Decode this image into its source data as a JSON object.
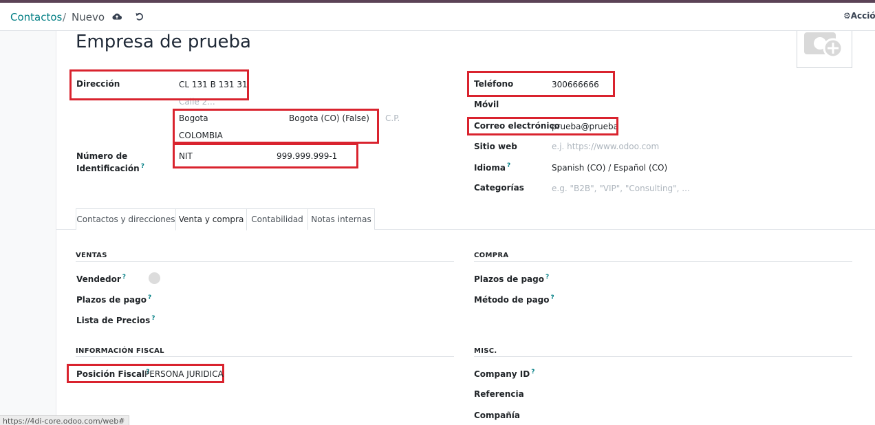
{
  "breadcrumb": {
    "parent": "Contactos",
    "separator": "/",
    "current": "Nuevo"
  },
  "actions_label": "Acción",
  "icons": {
    "save": "cloud-upload-icon",
    "discard": "undo-icon",
    "actions": "gear-icon",
    "avatar": "camera-plus-icon"
  },
  "record": {
    "name": "Empresa de prueba"
  },
  "address": {
    "label": "Dirección",
    "street": "CL 131 B 131 31",
    "street2_placeholder": "Calle 2...",
    "city": "Bogota",
    "state": "Bogota (CO) (False)",
    "zip_placeholder": "C.P.",
    "country": "COLOMBIA"
  },
  "identification": {
    "label_line1": "Número de",
    "label_line2": "Identificación",
    "help": "?",
    "type": "NIT",
    "number": "999.999.999-1"
  },
  "contact": {
    "phone_label": "Teléfono",
    "phone": "300666666",
    "mobile_label": "Móvil",
    "email_label": "Correo electrónico",
    "email": "prueba@prueba",
    "website_label": "Sitio web",
    "website_placeholder": "e.j. https://www.odoo.com",
    "language_label": "Idioma",
    "language_help": "?",
    "language": "Spanish (CO) / Español (CO)",
    "tags_label": "Categorías",
    "tags_placeholder": "e.g. \"B2B\", \"VIP\", \"Consulting\", ..."
  },
  "tabs": [
    {
      "label": "Contactos y direcciones",
      "active": false
    },
    {
      "label": "Venta y compra",
      "active": true
    },
    {
      "label": "Contabilidad",
      "active": false
    },
    {
      "label": "Notas internas",
      "active": false
    }
  ],
  "sales": {
    "title": "VENTAS",
    "salesperson_label": "Vendedor",
    "payment_terms_label": "Plazos de pago",
    "pricelist_label": "Lista de Precios",
    "help": "?"
  },
  "purchase": {
    "title": "COMPRA",
    "payment_terms_label": "Plazos de pago",
    "payment_method_label": "Método de pago",
    "help": "?"
  },
  "fiscal": {
    "title": "INFORMACIÓN FISCAL",
    "position_label": "Posición Fiscal",
    "help": "?",
    "position": "PERSONA JURIDICA"
  },
  "misc": {
    "title": "MISC.",
    "company_id_label": "Company ID",
    "help": "?",
    "reference_label": "Referencia",
    "company_label": "Compañía"
  },
  "status_bar": {
    "url": "https://4di-core.odoo.com/web#"
  },
  "colors": {
    "highlight_box": "#d9232e",
    "link": "#017e84",
    "top_bar": "#5b4256"
  }
}
